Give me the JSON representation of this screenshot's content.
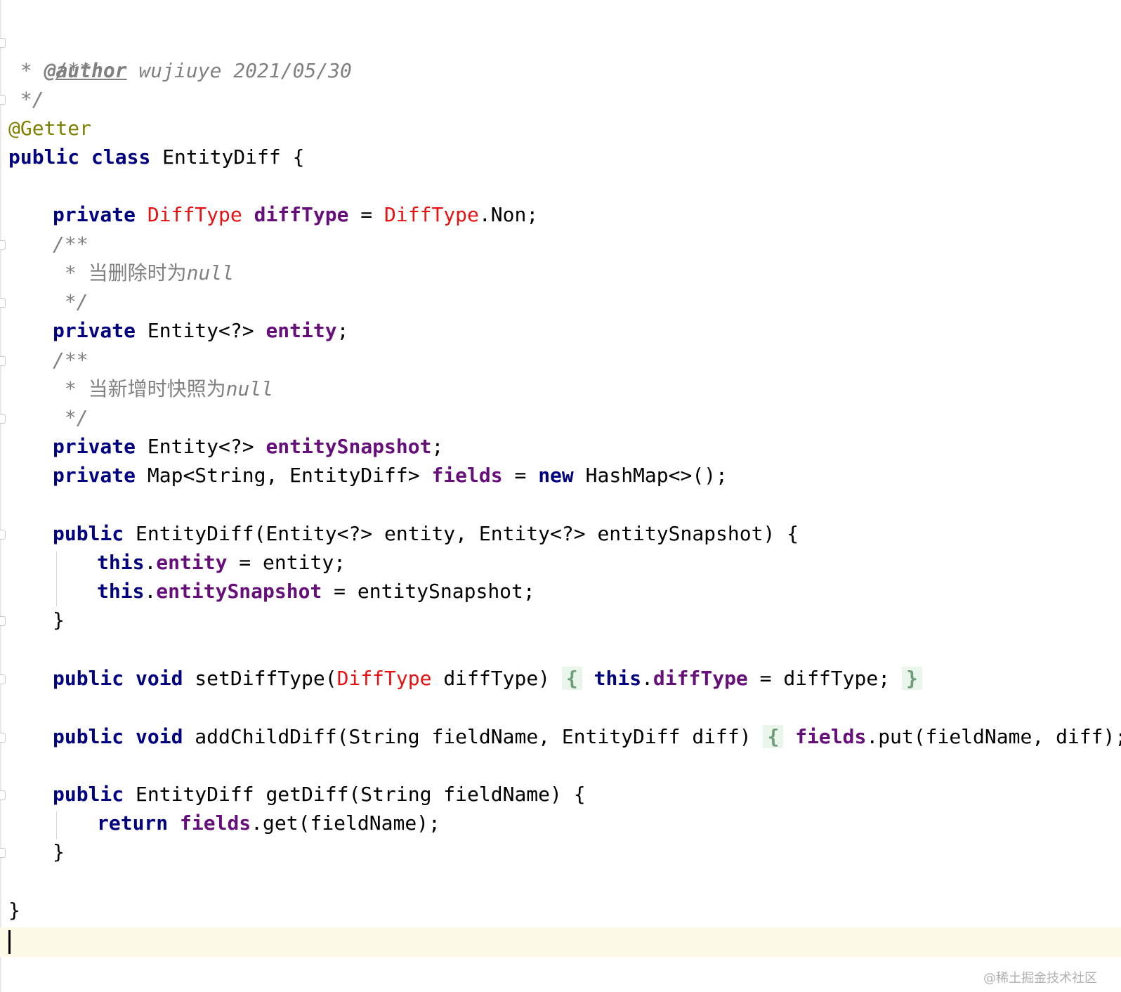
{
  "code": {
    "line1": "/**",
    "line2_star": " * ",
    "line2_tag": "@author",
    "line2_text": " wujiuye 2021/05/30",
    "line3": " */",
    "line4": "@Getter",
    "line5_kw1": "public",
    "line5_kw2": "class",
    "line5_rest": " EntityDiff {",
    "line7_kw": "private",
    "line7_type": "DiffType",
    "line7_field": "diffType",
    "line7_eq": " = ",
    "line7_type2": "DiffType",
    "line7_rest": ".Non;",
    "line8": "/**",
    "line9_star": " * ",
    "line9_cn": "当删除时为",
    "line9_null": "null",
    "line10": " */",
    "line11_kw": "private",
    "line11_type": " Entity<?> ",
    "line11_field": "entity",
    "line11_rest": ";",
    "line12": "/**",
    "line13_star": " * ",
    "line13_cn": "当新增时快照为",
    "line13_null": "null",
    "line14": " */",
    "line15_kw": "private",
    "line15_type": " Entity<?> ",
    "line15_field": "entitySnapshot",
    "line15_rest": ";",
    "line16_kw": "private",
    "line16_type": " Map<String, EntityDiff> ",
    "line16_field": "fields",
    "line16_eq": " = ",
    "line16_kw2": "new",
    "line16_rest": " HashMap<>();",
    "line18_kw": "public",
    "line18_rest": " EntityDiff(Entity<?> entity, Entity<?> entitySnapshot) {",
    "line19_kw": "this",
    "line19_dot": ".",
    "line19_field": "entity",
    "line19_rest": " = entity;",
    "line20_kw": "this",
    "line20_dot": ".",
    "line20_field": "entitySnapshot",
    "line20_rest": " = entitySnapshot;",
    "line21": "}",
    "line23_kw1": "public",
    "line23_kw2": "void",
    "line23_name": " setDiffType(",
    "line23_type": "DiffType",
    "line23_param": " diffType)",
    "line23_open": "{",
    "line23_kw3": "this",
    "line23_dot": ".",
    "line23_field": "diffType",
    "line23_rest": " = diffType; ",
    "line23_close": "}",
    "line25_kw1": "public",
    "line25_kw2": "void",
    "line25_name": " addChildDiff(String fieldName, EntityDiff diff)",
    "line25_open": "{",
    "line25_field": "fields",
    "line25_rest": ".put(fieldName, diff);",
    "line25_close": "}",
    "line27_kw": "public",
    "line27_rest": " EntityDiff getDiff(String fieldName) {",
    "line28_kw": "return",
    "line28_field": "fields",
    "line28_rest": ".get(fieldName);",
    "line29": "}",
    "line31": "}"
  },
  "watermark": "@稀土掘金技术社区",
  "colors": {
    "keyword": "#000080",
    "field": "#660e7a",
    "type_highlight": "#e81010",
    "annotation": "#808000",
    "comment": "#808080",
    "caret_row": "#fcfae6",
    "fold_brace_bg": "#e9f4ea"
  }
}
